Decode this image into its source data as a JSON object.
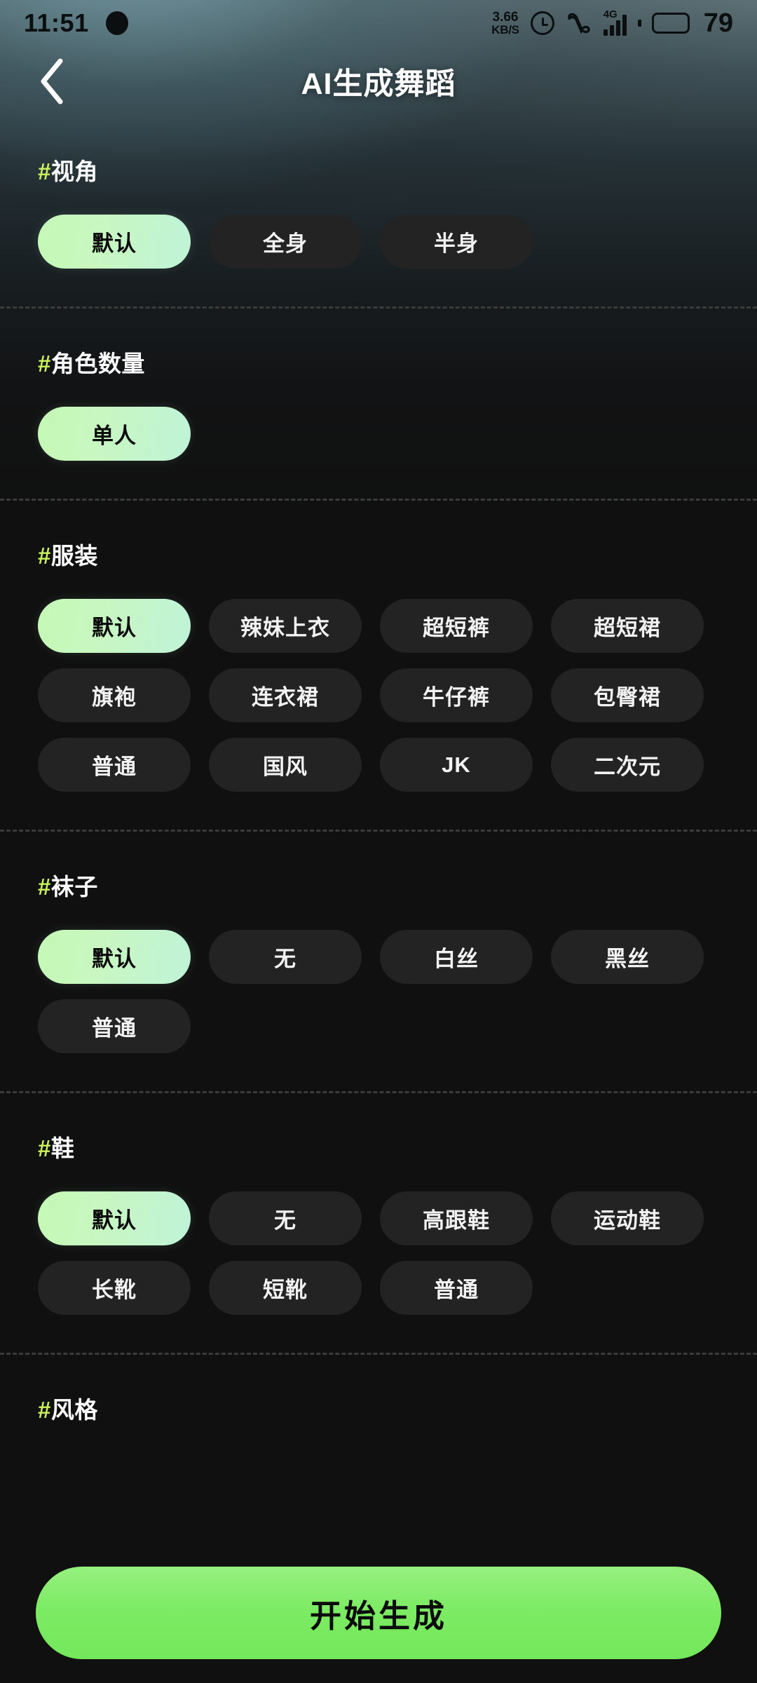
{
  "status_bar": {
    "time": "11:51",
    "network_speed_value": "3.66",
    "network_speed_unit": "KB/S",
    "signal_type": "4G",
    "battery_percent": "79",
    "icons": [
      "camera-punchhole",
      "alarm-clock-icon",
      "vpn-icon",
      "signal-bars-icon",
      "battery-icon"
    ]
  },
  "header": {
    "title": "AI生成舞蹈",
    "back_icon": "chevron-left-icon"
  },
  "colors": {
    "accent_green": "#c9f25c",
    "chip_selected_from": "#c4f9b6",
    "chip_selected_to": "#bff3d8",
    "chip_unselected": "#232323",
    "cta_green": "#7ceb63",
    "background": "#101010"
  },
  "sections": [
    {
      "id": "viewpoint",
      "hash": "#",
      "label": "视角",
      "options": [
        {
          "label": "默认",
          "selected": true
        },
        {
          "label": "全身",
          "selected": false
        },
        {
          "label": "半身",
          "selected": false
        }
      ]
    },
    {
      "id": "character-count",
      "hash": "#",
      "label": "角色数量",
      "options": [
        {
          "label": "单人",
          "selected": true
        }
      ]
    },
    {
      "id": "clothing",
      "hash": "#",
      "label": "服装",
      "options": [
        {
          "label": "默认",
          "selected": true
        },
        {
          "label": "辣妹上衣",
          "selected": false
        },
        {
          "label": "超短裤",
          "selected": false
        },
        {
          "label": "超短裙",
          "selected": false
        },
        {
          "label": "旗袍",
          "selected": false
        },
        {
          "label": "连衣裙",
          "selected": false
        },
        {
          "label": "牛仔裤",
          "selected": false
        },
        {
          "label": "包臀裙",
          "selected": false
        },
        {
          "label": "普通",
          "selected": false
        },
        {
          "label": "国风",
          "selected": false
        },
        {
          "label": "JK",
          "selected": false
        },
        {
          "label": "二次元",
          "selected": false
        }
      ]
    },
    {
      "id": "socks",
      "hash": "#",
      "label": "袜子",
      "options": [
        {
          "label": "默认",
          "selected": true
        },
        {
          "label": "无",
          "selected": false
        },
        {
          "label": "白丝",
          "selected": false
        },
        {
          "label": "黑丝",
          "selected": false
        },
        {
          "label": "普通",
          "selected": false
        }
      ]
    },
    {
      "id": "shoes",
      "hash": "#",
      "label": "鞋",
      "options": [
        {
          "label": "默认",
          "selected": true
        },
        {
          "label": "无",
          "selected": false
        },
        {
          "label": "高跟鞋",
          "selected": false
        },
        {
          "label": "运动鞋",
          "selected": false
        },
        {
          "label": "长靴",
          "selected": false
        },
        {
          "label": "短靴",
          "selected": false
        },
        {
          "label": "普通",
          "selected": false
        }
      ]
    },
    {
      "id": "style",
      "hash": "#",
      "label": "风格",
      "options": []
    }
  ],
  "cta": {
    "label": "开始生成"
  }
}
